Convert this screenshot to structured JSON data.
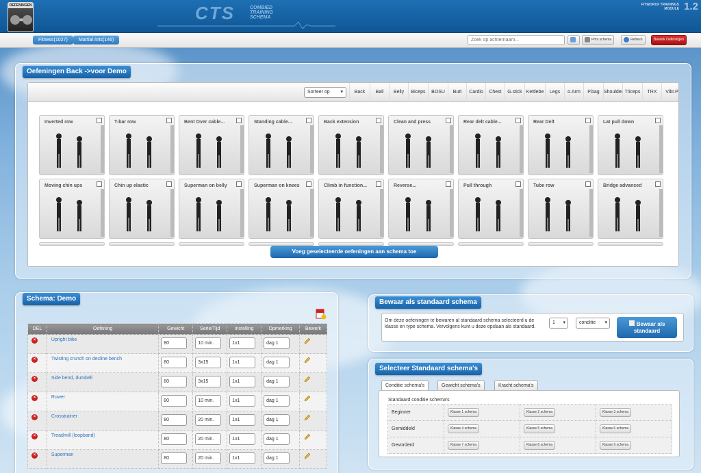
{
  "header": {
    "logo_label": "OEFENINGEN",
    "brand": "CTS",
    "brand_sub": "COMBIED TRAINING SCHEMA",
    "module": "FITWORXX TRAININGS MODULE",
    "version": "1.2"
  },
  "nav": {
    "crumbs": [
      "Fitness(1027)",
      "Martial Arts(146)"
    ],
    "search_placeholder": "Zoek op achternaam...",
    "print_label": "Print schema",
    "refresh_label": "Refresh",
    "edit_label": "Bewerk Oefeningen"
  },
  "exercises": {
    "title": "Oefeningen Back ->voor Demo",
    "sort_label": "Sorteer op",
    "filters": [
      "Back",
      "Ball",
      "Belly",
      "Biceps",
      "BOSU",
      "Butt",
      "Cardio",
      "Chest",
      "G.stick",
      "Kettlebe",
      "Legs",
      "o.Arm",
      "P.bag",
      "Shoulder",
      "Triceps",
      "TRX",
      "Vibr.P"
    ],
    "cards": [
      "Inverted row",
      "T-bar row",
      "Bent Over cable...",
      "Standing cable...",
      "Back extension",
      "Clean and press",
      "Rear delt cable...",
      "Rear Delt",
      "Lat pull down",
      "Moving chin ups",
      "Chin up elastic",
      "Superman on belly",
      "Superman on knees",
      "Climb in function...",
      "Reverse...",
      "Pull through",
      "Tube row",
      "Bridge advanced"
    ],
    "add_button": "Voeg geselecteerde oefeningen aan schema toe"
  },
  "schema": {
    "title": "Schema: Demo",
    "columns": [
      "DEL",
      "Oefening",
      "Gewicht",
      "Serie/Tijd",
      "Instelling",
      "Opmerking",
      "Bewerk"
    ],
    "rows": [
      {
        "name": "Upright bike",
        "gewicht": "80",
        "serie": "10 min.",
        "instelling": "1x1",
        "opmerking": "dag 1"
      },
      {
        "name": "Twisting crunch on decline bench",
        "gewicht": "80",
        "serie": "3x15",
        "instelling": "1x1",
        "opmerking": "dag 1"
      },
      {
        "name": "Side bend, dumbell",
        "gewicht": "80",
        "serie": "3x15",
        "instelling": "1x1",
        "opmerking": "dag 1"
      },
      {
        "name": "Rower",
        "gewicht": "80",
        "serie": "10 min.",
        "instelling": "1x1",
        "opmerking": "dag 1"
      },
      {
        "name": "Crosstrainer",
        "gewicht": "80",
        "serie": "20 min.",
        "instelling": "1x1",
        "opmerking": "dag 1"
      },
      {
        "name": "Treadmill (loopband)",
        "gewicht": "80",
        "serie": "20 min.",
        "instelling": "1x1",
        "opmerking": "dag 1"
      },
      {
        "name": "Superman",
        "gewicht": "80",
        "serie": "20 min.",
        "instelling": "1x1",
        "opmerking": "dag 1"
      }
    ]
  },
  "bewaar": {
    "title": "Bewaar als standaard schema",
    "text": "Om deze oefeningen te bewaren al standaard schema selecteerd u de klasse en type schema. Vervolgens kunt u deze opslaan als standaard.",
    "klasse_value": "1",
    "type_value": "conditie",
    "button": "Bewaar als standaard"
  },
  "standaard": {
    "title": "Selecteer Standaard schema's",
    "tabs": [
      "Conditie schema's",
      "Gewicht schema's",
      "Kracht schema's"
    ],
    "grid_title": "Standaard conditie schema's",
    "levels": [
      {
        "label": "Beginner",
        "buttons": [
          "Klasse 1 schema",
          "Klasse 2 schema",
          "Klasse 3 schema"
        ]
      },
      {
        "label": "Gemiddeld",
        "buttons": [
          "Klasse 4 schema",
          "Klasse 5 schema",
          "Klasse 6 schema"
        ]
      },
      {
        "label": "Gevorderd",
        "buttons": [
          "Klasse 7 schema",
          "Klasse 8 schema",
          "Klasse 9 schema"
        ]
      }
    ]
  },
  "colors": {
    "accent": "#1e67ad",
    "delete": "#cc2222",
    "header": "#0f5796"
  }
}
